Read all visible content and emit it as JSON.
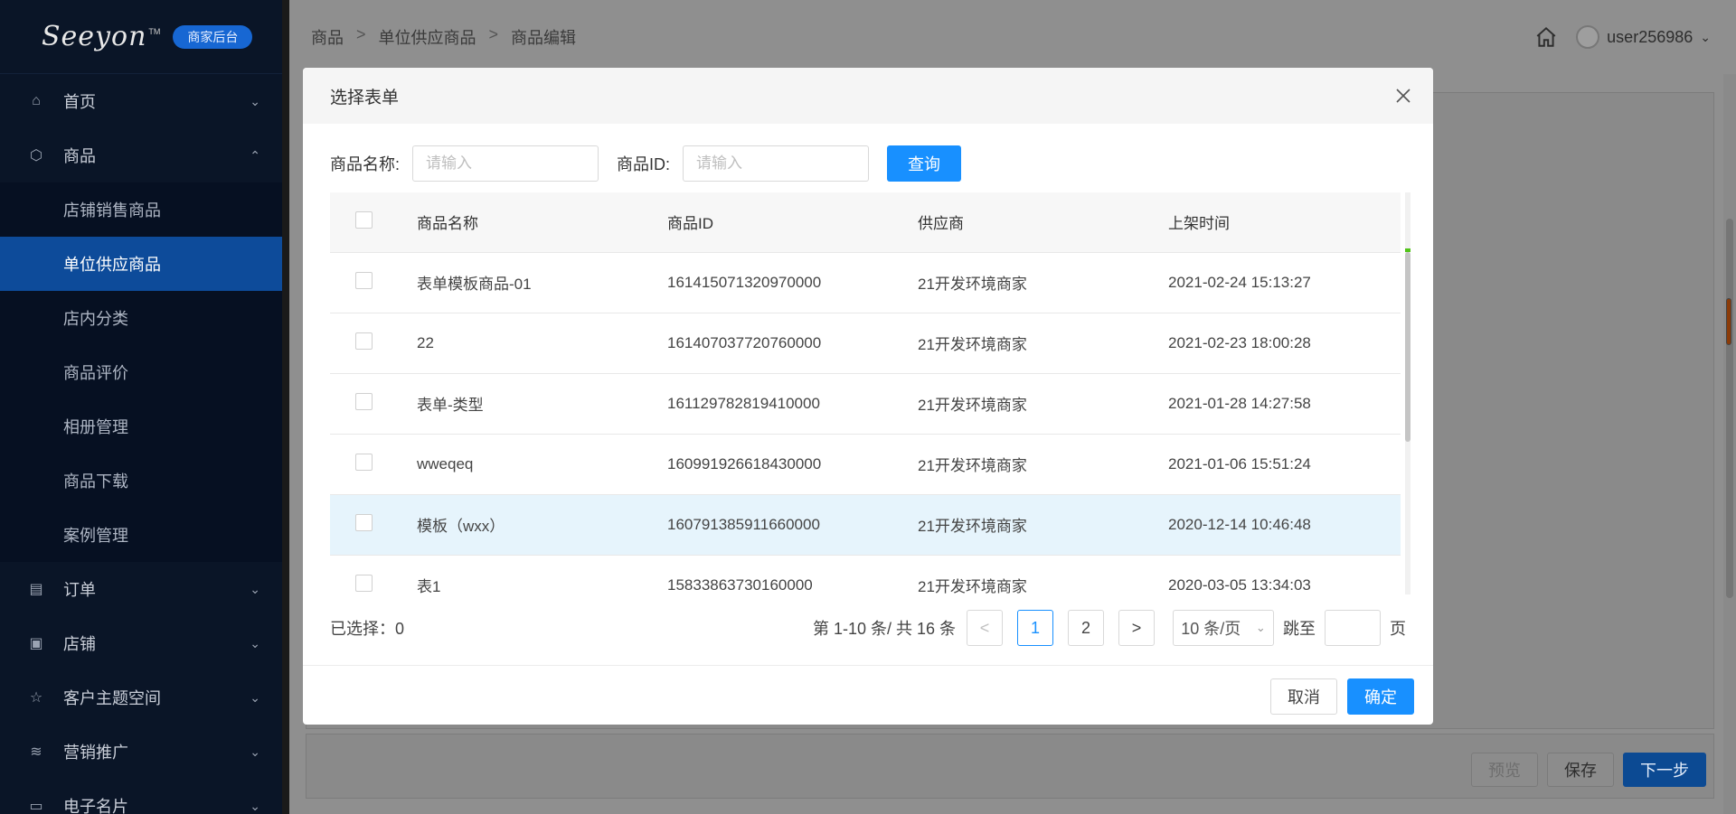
{
  "sidebar": {
    "logo": "Seeyon",
    "logo_tm": "TM",
    "badge": "商家后台",
    "items": [
      {
        "label": "首页",
        "icon": "home-icon",
        "chev": "⌄"
      },
      {
        "label": "商品",
        "icon": "cube-icon",
        "chev": "⌃"
      },
      {
        "label": "订单",
        "icon": "document-icon",
        "chev": "⌄"
      },
      {
        "label": "店铺",
        "icon": "shop-icon",
        "chev": "⌄"
      },
      {
        "label": "客户主题空间",
        "icon": "star-icon",
        "chev": "⌄"
      },
      {
        "label": "营销推广",
        "icon": "layers-icon",
        "chev": "⌄"
      },
      {
        "label": "电子名片",
        "icon": "card-icon",
        "chev": "⌄"
      }
    ],
    "sub_items": [
      {
        "label": "店铺销售商品"
      },
      {
        "label": "单位供应商品"
      },
      {
        "label": "店内分类"
      },
      {
        "label": "商品评价"
      },
      {
        "label": "相册管理"
      },
      {
        "label": "商品下载"
      },
      {
        "label": "案例管理"
      }
    ]
  },
  "header": {
    "breadcrumb": [
      "商品",
      "单位供应商品",
      "商品编辑"
    ],
    "separator": ">",
    "username": "user256986",
    "user_chevron": "⌄"
  },
  "footer": {
    "preview": "预览",
    "save": "保存",
    "next": "下一步"
  },
  "modal": {
    "title": "选择表单",
    "search": {
      "name_label": "商品名称:",
      "name_placeholder": "请输入",
      "id_label": "商品ID:",
      "id_placeholder": "请输入",
      "query_button": "查询"
    },
    "table": {
      "headers": [
        "商品名称",
        "商品ID",
        "供应商",
        "上架时间"
      ],
      "rows": [
        [
          "表单模板商品-01",
          "161415071320970000",
          "21开发环境商家",
          "2021-02-24 15:13:27"
        ],
        [
          "22",
          "161407037720760000",
          "21开发环境商家",
          "2021-02-23 18:00:28"
        ],
        [
          "表单-类型",
          "161129782819410000",
          "21开发环境商家",
          "2021-01-28 14:27:58"
        ],
        [
          "wweqeq",
          "160991926618430000",
          "21开发环境商家",
          "2021-01-06 15:51:24"
        ],
        [
          "模板（wxx）",
          "160791385911660000",
          "21开发环境商家",
          "2020-12-14 10:46:48"
        ],
        [
          "表1",
          "15833863730160000",
          "21开发环境商家",
          "2020-03-05 13:34:03"
        ]
      ]
    },
    "selected_label": "已选择：0",
    "pagination": {
      "summary": "第 1-10 条/ 共 16 条",
      "prev": "<",
      "pages": [
        "1",
        "2"
      ],
      "next": ">",
      "page_size": "10 条/页",
      "page_size_chevron": "⌄",
      "jump_label": "跳至",
      "jump_suffix": "页"
    },
    "cancel": "取消",
    "confirm": "确定"
  }
}
